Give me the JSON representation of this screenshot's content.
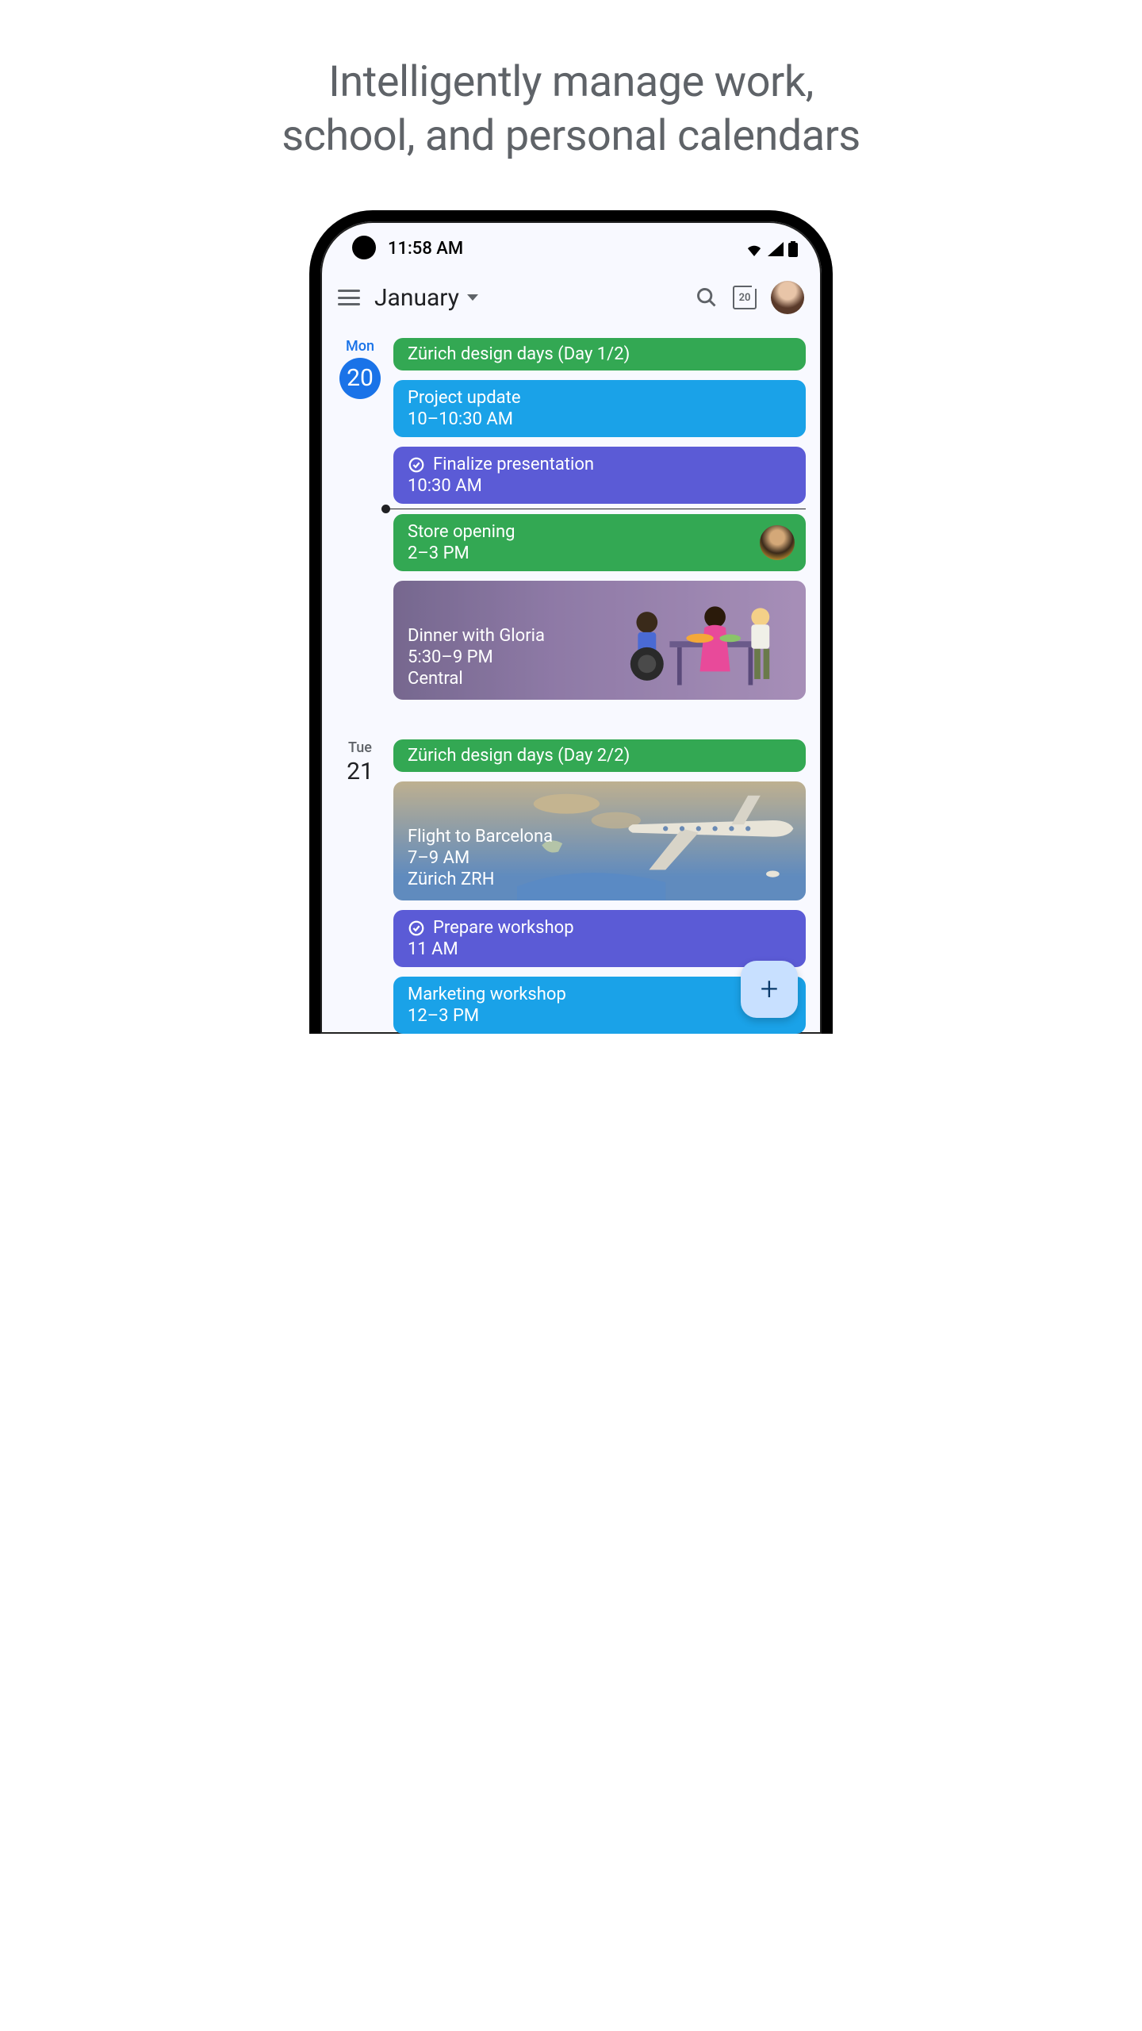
{
  "marketing": {
    "headline": "Intelligently manage work, school, and personal calendars"
  },
  "status": {
    "time": "11:58 AM"
  },
  "header": {
    "month": "January",
    "today_number": "20"
  },
  "colors": {
    "green": "#33a853",
    "blue": "#1aa2e8",
    "purple": "#5b5bd6",
    "primary_blue": "#1a73e8",
    "fab_bg": "#c8e0ff"
  },
  "days": [
    {
      "name": "Mon",
      "number": "20",
      "is_today": true,
      "events": [
        {
          "title": "Zürich design days (Day 1/2)",
          "color": "green",
          "single": true
        },
        {
          "title": "Project update",
          "time": "10–10:30 AM",
          "color": "blue"
        },
        {
          "title": "Finalize presentation",
          "time": "10:30 AM",
          "color": "purple",
          "has_task_icon": true,
          "now_after": true
        },
        {
          "title": "Store opening",
          "time": "2–3 PM",
          "color": "green",
          "has_avatar": true
        },
        {
          "title": "Dinner with Gloria",
          "time": "5:30–9 PM",
          "location": "Central",
          "illustration": "dinner"
        }
      ]
    },
    {
      "name": "Tue",
      "number": "21",
      "is_today": false,
      "events": [
        {
          "title": "Zürich design days (Day 2/2)",
          "color": "green",
          "single": true
        },
        {
          "title": "Flight to Barcelona",
          "time": "7–9 AM",
          "location": "Zürich ZRH",
          "illustration": "flight"
        },
        {
          "title": "Prepare workshop",
          "time": "11 AM",
          "color": "purple",
          "has_task_icon": true
        },
        {
          "title": "Marketing workshop",
          "time": "12–3 PM",
          "color": "blue"
        }
      ]
    }
  ],
  "fab": {
    "label": "+"
  }
}
